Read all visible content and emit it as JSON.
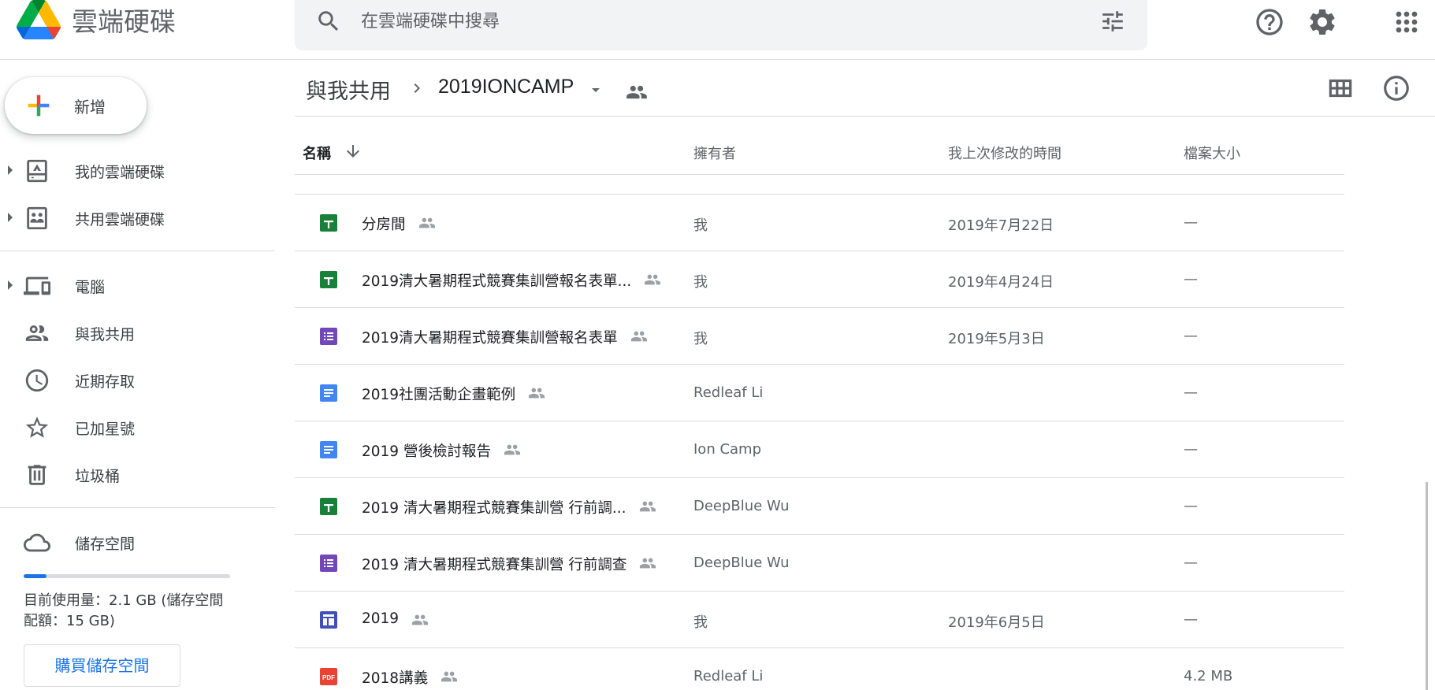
{
  "app": {
    "title": "雲端硬碟"
  },
  "search": {
    "placeholder": "在雲端硬碟中搜尋",
    "value": ""
  },
  "sidebar": {
    "new_label": "新增",
    "items": [
      {
        "label": "我的雲端硬碟",
        "icon": "my-drive-icon",
        "expandable": true
      },
      {
        "label": "共用雲端硬碟",
        "icon": "shared-drives-icon",
        "expandable": true
      },
      {
        "label": "電腦",
        "icon": "computers-icon",
        "expandable": true
      },
      {
        "label": "與我共用",
        "icon": "shared-with-me-icon",
        "expandable": false
      },
      {
        "label": "近期存取",
        "icon": "recent-icon",
        "expandable": false
      },
      {
        "label": "已加星號",
        "icon": "star-icon",
        "expandable": false
      },
      {
        "label": "垃圾桶",
        "icon": "trash-icon",
        "expandable": false
      },
      {
        "label": "儲存空間",
        "icon": "cloud-icon",
        "expandable": false
      }
    ],
    "storage": {
      "used_fraction": 0.11,
      "text": "目前使用量：2.1 GB (儲存空間配額：15 GB)",
      "buy_label": "購買儲存空間"
    }
  },
  "breadcrumb": {
    "root": "與我共用",
    "current": "2019IONCAMP"
  },
  "table": {
    "headers": {
      "name": "名稱",
      "owner": "擁有者",
      "modified": "我上次修改的時間",
      "size": "檔案大小"
    },
    "rows": [
      {
        "type": "sheets",
        "name": "分房間",
        "owner": "我",
        "modified": "2019年7月22日",
        "size": "—"
      },
      {
        "type": "sheets",
        "name": "2019清大暑期程式競賽集訓營報名表單...",
        "owner": "我",
        "modified": "2019年4月24日",
        "size": "—"
      },
      {
        "type": "forms",
        "name": "2019清大暑期程式競賽集訓營報名表單",
        "owner": "我",
        "modified": "2019年5月3日",
        "size": "—"
      },
      {
        "type": "docs",
        "name": "2019社團活動企畫範例",
        "owner": "Redleaf Li",
        "modified": "",
        "size": "—"
      },
      {
        "type": "docs",
        "name": "2019 營後檢討報告",
        "owner": "Ion Camp",
        "modified": "",
        "size": "—"
      },
      {
        "type": "sheets",
        "name": "2019 清大暑期程式競賽集訓營 行前調...",
        "owner": "DeepBlue Wu",
        "modified": "",
        "size": "—"
      },
      {
        "type": "forms",
        "name": "2019 清大暑期程式競賽集訓營 行前調查",
        "owner": "DeepBlue Wu",
        "modified": "",
        "size": "—"
      },
      {
        "type": "sites",
        "name": "2019",
        "owner": "我",
        "modified": "2019年6月5日",
        "size": "—"
      },
      {
        "type": "pdf",
        "name": "2018講義",
        "owner": "Redleaf Li",
        "modified": "",
        "size": "4.2 MB"
      }
    ]
  },
  "colors": {
    "sheets": "#188038",
    "forms": "#7248b9",
    "docs": "#4285f4",
    "sites": "#3f51b5",
    "pdf": "#ea4335",
    "accent": "#1a73e8"
  }
}
